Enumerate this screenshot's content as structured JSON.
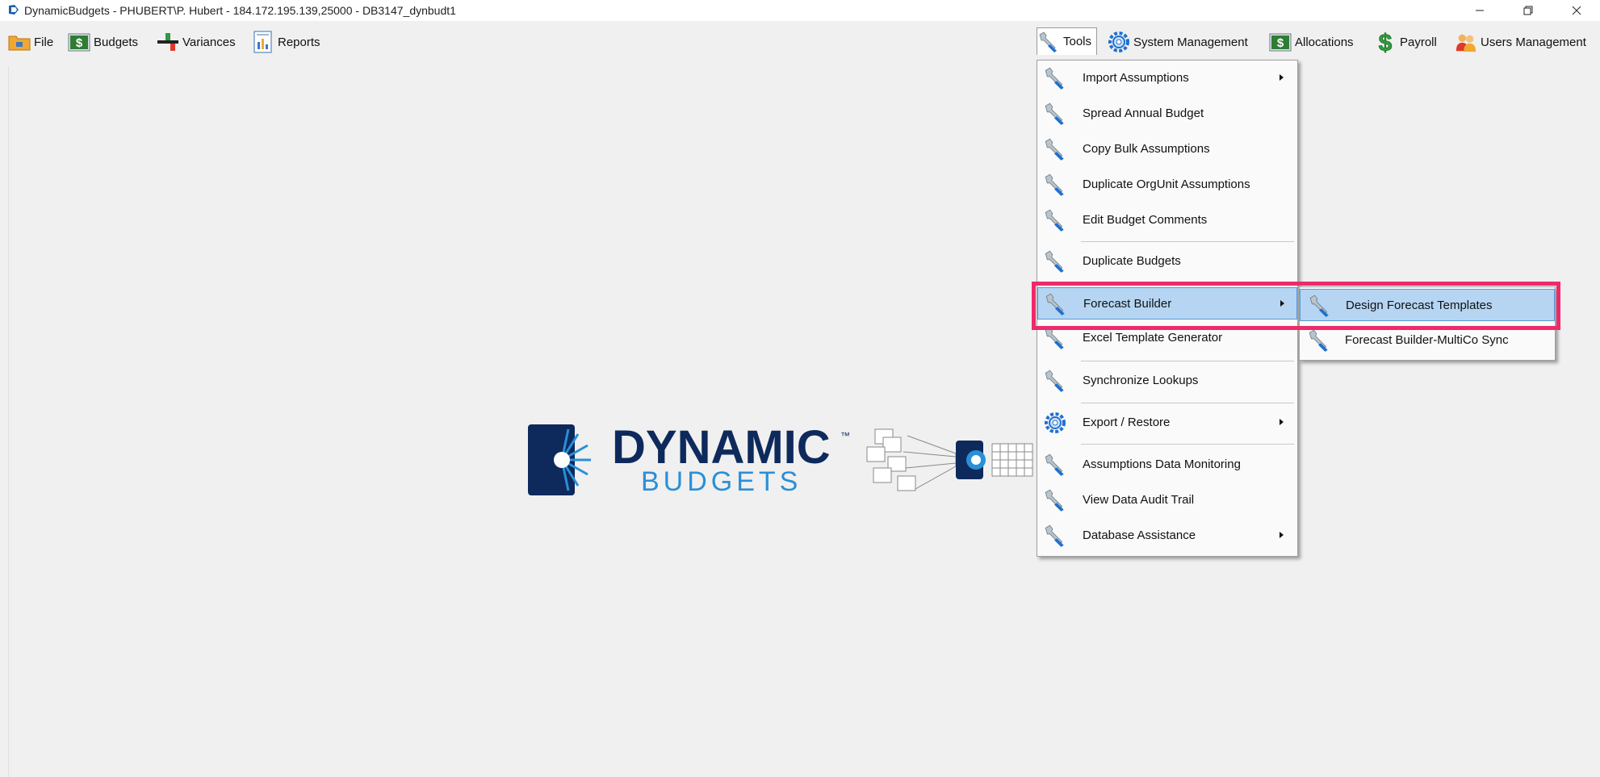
{
  "window": {
    "title": "DynamicBudgets - PHUBERT\\P. Hubert - 184.172.195.139,25000 - DB3147_dynbudt1",
    "controls": [
      "minimize-icon",
      "restore-icon",
      "close-icon"
    ]
  },
  "menubar": {
    "left": [
      {
        "label": "File",
        "icon": "folder-icon"
      },
      {
        "label": "Budgets",
        "icon": "dollar-icon"
      },
      {
        "label": "Variances",
        "icon": "variance-icon"
      },
      {
        "label": "Reports",
        "icon": "report-icon"
      }
    ],
    "right": [
      {
        "label": "Tools",
        "icon": "wrench-icon"
      },
      {
        "label": "System Management",
        "icon": "gear-icon"
      },
      {
        "label": "Allocations",
        "icon": "dollar-icon"
      },
      {
        "label": "Payroll",
        "icon": "dollar-sign-icon"
      },
      {
        "label": "Users Management",
        "icon": "users-icon"
      }
    ]
  },
  "tools_menu": {
    "items": [
      {
        "label": "Import Assumptions",
        "icon": "wrench-icon",
        "submenu": true
      },
      {
        "label": "Spread Annual Budget",
        "icon": "wrench-icon",
        "submenu": false
      },
      {
        "label": "Copy Bulk Assumptions",
        "icon": "wrench-icon",
        "submenu": false
      },
      {
        "label": "Duplicate OrgUnit Assumptions",
        "icon": "wrench-icon",
        "submenu": false
      },
      {
        "label": "Edit Budget Comments",
        "icon": "wrench-icon",
        "submenu": false
      },
      {
        "label": "Duplicate Budgets",
        "icon": "wrench-icon",
        "submenu": false
      },
      {
        "label": "Forecast Builder",
        "icon": "wrench-icon",
        "submenu": true,
        "highlighted": true
      },
      {
        "label": "Excel Template Generator",
        "icon": "wrench-icon",
        "submenu": false
      },
      {
        "label": "Synchronize Lookups",
        "icon": "wrench-icon",
        "submenu": false
      },
      {
        "label": "Export / Restore",
        "icon": "gear-icon",
        "submenu": true
      },
      {
        "label": "Assumptions Data Monitoring",
        "icon": "wrench-icon",
        "submenu": false
      },
      {
        "label": "View Data Audit Trail",
        "icon": "wrench-icon",
        "submenu": false
      },
      {
        "label": "Database Assistance",
        "icon": "wrench-icon",
        "submenu": true
      }
    ]
  },
  "forecast_submenu": {
    "items": [
      {
        "label": "Design Forecast Templates",
        "icon": "wrench-icon",
        "highlighted": true
      },
      {
        "label": "Forecast Builder-MultiCo Sync",
        "icon": "wrench-icon",
        "highlighted": false
      }
    ]
  },
  "logo": {
    "line1": "DYNAMIC",
    "line2": "BUDGETS",
    "trademark": "™"
  },
  "colors": {
    "highlight": "#b5d5f2",
    "highlight_border": "#5a9ad8",
    "annotation": "#ee2a6b",
    "logo_navy": "#0e2a5c",
    "logo_blue": "#2a8fd8"
  }
}
